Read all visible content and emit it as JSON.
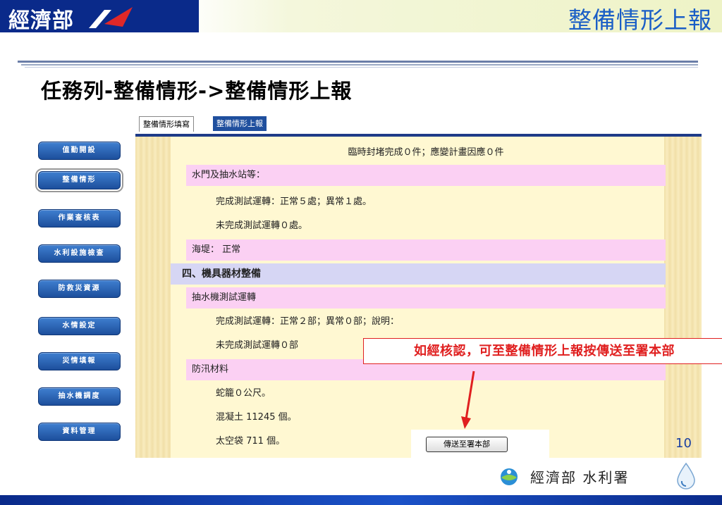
{
  "header": {
    "logo_text": "經濟部",
    "slide_title": "整備情形上報"
  },
  "heading": "任務列-整備情形->整備情形上報",
  "sidebar": {
    "items": [
      {
        "label": "值勤開設"
      },
      {
        "label": "整備情形",
        "active": true
      },
      {
        "label": "作業查核表"
      },
      {
        "label": "水利設施檢查"
      },
      {
        "label": "防救災資源"
      },
      {
        "label": "水情設定"
      },
      {
        "label": "災情填報"
      },
      {
        "label": "抽水機調度"
      },
      {
        "label": "資料管理"
      }
    ]
  },
  "tabs": [
    {
      "label": "整備情形填寫"
    },
    {
      "label": "整備情形上報",
      "active": true
    }
  ],
  "content": {
    "row1": "臨時封堵完成０件；應變計畫因應０件",
    "row2": "水門及抽水站等：",
    "row3": "完成測試運轉：正常５處；異常１處。",
    "row4": "未完成測試運轉０處。",
    "row5": "海堤：  正常",
    "row6": "四、機具器材整備",
    "row7": "抽水機測試運轉",
    "row8": "完成測試運轉：正常２部；異常０部；說明：",
    "row9": "未完成測試運轉０部",
    "row10": "防汛材料",
    "row11": "蛇籠０公尺。",
    "row12": "混凝土 11245 個。",
    "row13": "太空袋 711 個。"
  },
  "callout": "如經核認，可至整備情形上報按傳送至署本部",
  "send_button": "傳送至署本部",
  "page_number": "10",
  "footer": {
    "org": "經濟部 水利署"
  },
  "colors": {
    "brand_blue": "#0a2a8a",
    "title_blue": "#1a5ec6",
    "callout_red": "#e02020",
    "content_bg": "#fff8d2",
    "pink_row": "#fbd0f3",
    "lavender_row": "#d6d6f4"
  }
}
